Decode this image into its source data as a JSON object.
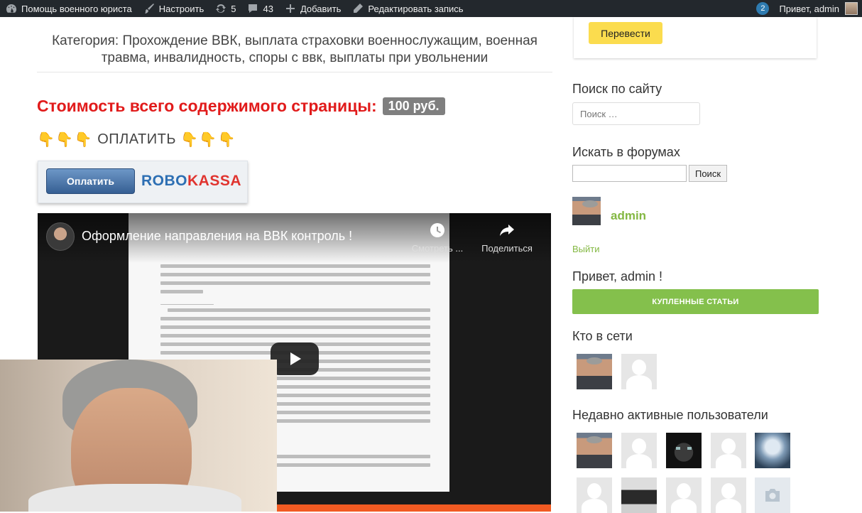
{
  "adminbar": {
    "site_name": "Помощь военного юриста",
    "customize": "Настроить",
    "updates_count": "5",
    "comments_count": "43",
    "add_new": "Добавить",
    "edit_post": "Редактировать запись",
    "notifications_count": "2",
    "greeting": "Привет, admin"
  },
  "main": {
    "category": "Категория: Прохождение ВВК, выплата страховки военнослужащим, военная травма, инвалидность, споры с ввк, выплаты при увольнении",
    "price_label": "Стоимость всего содержимого страницы:",
    "price_value": "100 руб.",
    "pay_text": "ОПЛАТИТЬ",
    "pay_hand_glyph": "👇",
    "robokassa_button": "Оплатить",
    "robokassa_logo_part1": "ROBO",
    "robokassa_logo_part2": "KASSA"
  },
  "video": {
    "title": "Оформление направления на ВВК контроль !",
    "watch_later": "Смотреть ...",
    "share": "Поделиться"
  },
  "sidebar": {
    "translate_button": "Перевести",
    "search_heading": "Поиск по сайту",
    "search_placeholder": "Поиск …",
    "forum_heading": "Искать в форумах",
    "forum_search_button": "Поиск",
    "user_name": "admin",
    "logout": "Выйти",
    "hello": "Привет, admin !",
    "purchased_button": "КУПЛЕННЫЕ СТАТЬИ",
    "online_heading": "Кто в сети",
    "recent_heading": "Недавно активные пользователи"
  },
  "colors": {
    "admin_bar": "#23282d",
    "price_red": "#e11b1b",
    "accent_green": "#84c04c",
    "translate_yellow": "#fbdc4e"
  }
}
